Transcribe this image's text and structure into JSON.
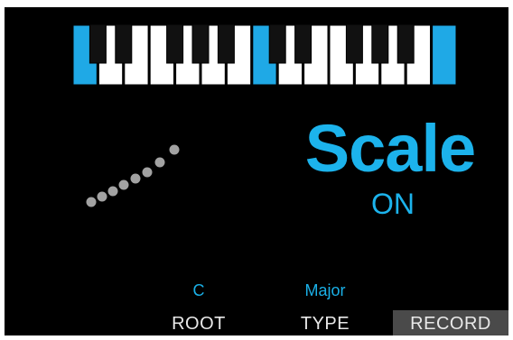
{
  "colors": {
    "accent": "#1cb3ec",
    "white_key": "#ffffff",
    "highlight_key": "#1fa9e6",
    "background": "#000000",
    "dot": "#a2a2a2",
    "softkey_active_bg": "#4a4a4a"
  },
  "keyboard": {
    "white_keys": 14,
    "highlighted_white_keys": [
      0,
      7,
      14
    ],
    "black_key_pattern": [
      1,
      1,
      0,
      1,
      1,
      1,
      0,
      1,
      1,
      0,
      1,
      1,
      1
    ]
  },
  "display": {
    "mode_title": "Scale",
    "mode_status": "ON",
    "arp_icon": "ascending-dots-icon"
  },
  "params": {
    "root_value": "C",
    "type_value": "Major"
  },
  "softkeys": {
    "root_label": "ROOT",
    "type_label": "TYPE",
    "record_label": "RECORD"
  }
}
